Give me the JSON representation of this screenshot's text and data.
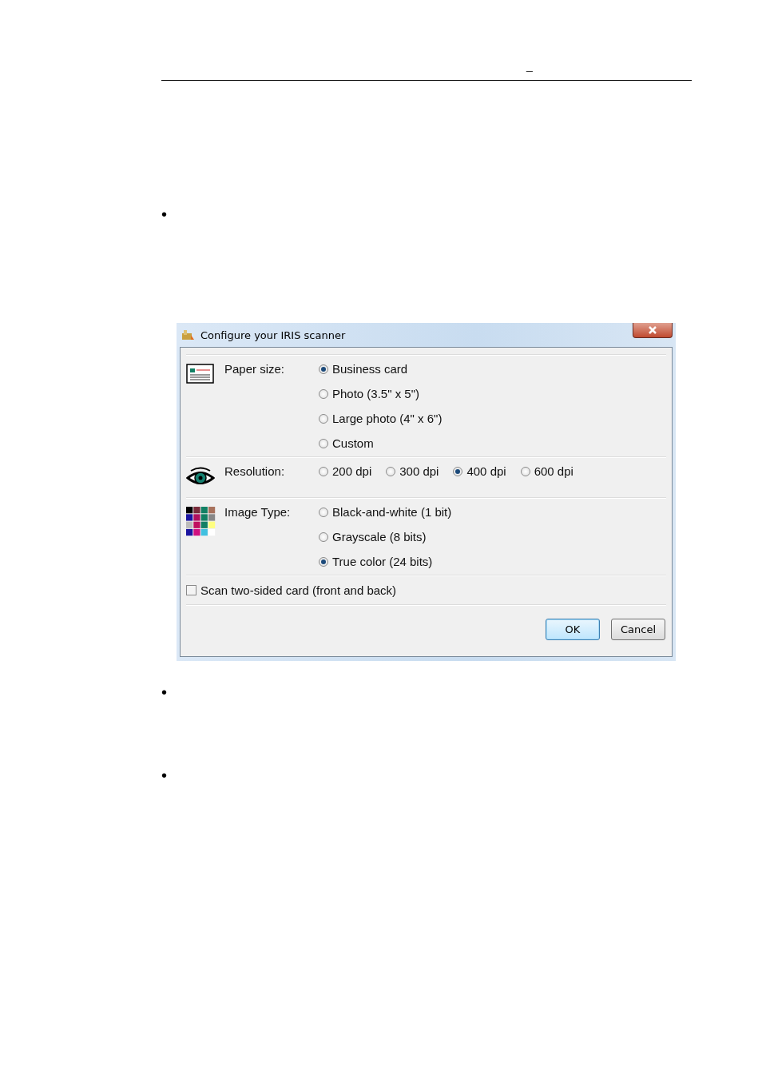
{
  "header": {
    "mark": "_"
  },
  "bullets": [
    "•",
    "•",
    "•"
  ],
  "dialog": {
    "title": "Configure your IRIS scanner",
    "sections": [
      {
        "kind": "card",
        "label": "Paper size:",
        "horizontal": false,
        "options": [
          {
            "label": "Business card",
            "selected": true
          },
          {
            "label": "Photo (3.5\" x 5\")",
            "selected": false
          },
          {
            "label": "Large photo (4\" x 6\")",
            "selected": false
          },
          {
            "label": "Custom",
            "selected": false
          }
        ]
      },
      {
        "kind": "eye",
        "label": "Resolution:",
        "horizontal": true,
        "options": [
          {
            "label": "200 dpi",
            "selected": false
          },
          {
            "label": "300 dpi",
            "selected": false
          },
          {
            "label": "400 dpi",
            "selected": true
          },
          {
            "label": "600 dpi",
            "selected": false
          }
        ]
      },
      {
        "kind": "palette",
        "label": "Image Type:",
        "horizontal": false,
        "options": [
          {
            "label": "Black-and-white (1 bit)",
            "selected": false
          },
          {
            "label": "Grayscale (8 bits)",
            "selected": false
          },
          {
            "label": "True color (24 bits)",
            "selected": true
          }
        ]
      }
    ],
    "checkbox": {
      "label": "Scan two-sided card (front and back)",
      "checked": false
    },
    "buttons": [
      {
        "label": "OK",
        "default": true
      },
      {
        "label": "Cancel",
        "default": false
      }
    ]
  }
}
